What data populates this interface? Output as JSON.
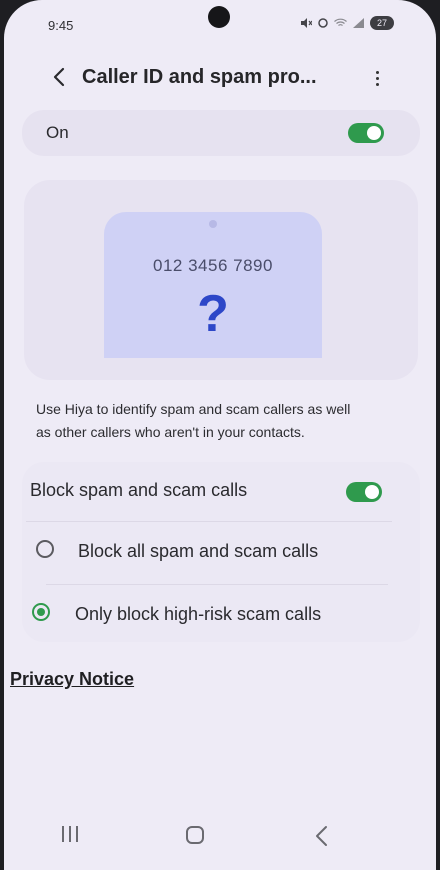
{
  "status": {
    "time": "9:45",
    "battery": "27"
  },
  "header": {
    "title": "Caller ID and spam pro..."
  },
  "master_toggle": {
    "label": "On",
    "state": true
  },
  "illustration": {
    "number": "012 3456 7890",
    "symbol": "?"
  },
  "description": {
    "line1": "Use Hiya to identify spam and scam callers as well",
    "line2": "as other callers who aren't in your contacts."
  },
  "block": {
    "label": "Block spam and scam calls",
    "state": true,
    "options": [
      {
        "label": "Block all spam and scam calls",
        "selected": false
      },
      {
        "label": "Only block high-risk scam calls",
        "selected": true
      }
    ]
  },
  "privacy_link": "Privacy Notice",
  "colors": {
    "accent": "#2f9a4d",
    "background": "#eeebf6",
    "question_mark": "#2d47c8"
  },
  "icons": [
    "back-arrow-icon",
    "more-vert-icon",
    "recent-apps-icon",
    "home-icon",
    "nav-back-icon"
  ]
}
